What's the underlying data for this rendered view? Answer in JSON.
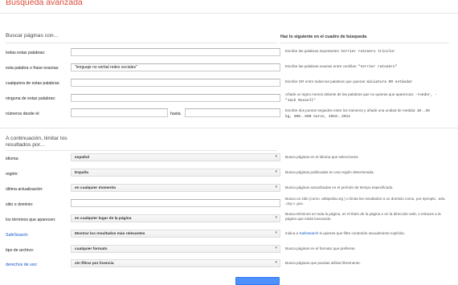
{
  "page_title": "Búsqueda avanzada",
  "find_section": {
    "heading": "Buscar páginas con...",
    "right_heading": "Haz lo siguiente en el cuadro de búsqueda",
    "rows": [
      {
        "label": "todas estas palabras:",
        "value": "",
        "desc_pre": "Escribe las palabras importantes: ",
        "desc_code": "terrier ratonero tricolor"
      },
      {
        "label": "esta palabra o frase exactas:",
        "value": "\"lenguaje no verbal redes sociales\"",
        "desc_pre": "Escribe las palabras exactas entre comillas: ",
        "desc_code": "\"terrier ratonero\""
      },
      {
        "label": "cualquiera de estas palabras:",
        "value": "",
        "desc_pre": "Escribe OR entre todas las palabras que quieras: ",
        "desc_code": "miniatura OR estándar"
      },
      {
        "label": "ninguna de estas palabras:",
        "value": "",
        "desc_pre": "Añade un signo menos delante de las palabras que no quieras que aparezcan: ",
        "desc_code": "-roedor, -\"Jack Russell\""
      }
    ],
    "numbers": {
      "label": "números desde el:",
      "from_value": "",
      "to_label": "hasta",
      "to_value": "",
      "desc_pre": "Escribe dos puntos seguidos entre los números y añade una unidad de medida: ",
      "desc_code": "10..35 kg, 300..500 euros, 2010..2011"
    }
  },
  "narrow_section": {
    "heading_line1": "A continuación, limitar los",
    "heading_line2": "resultados por...",
    "rows": [
      {
        "label": "idioma:",
        "value": "español",
        "desc": "Busca páginas en el idioma que selecciones."
      },
      {
        "label": "región:",
        "value": "España",
        "desc": "Busca páginas publicadas en una región determinada."
      },
      {
        "label": "última actualización:",
        "value": "en cualquier momento",
        "desc": "Busca páginas actualizadas en el período de tiempo especificado."
      },
      {
        "label": "sitio o dominio:",
        "value": "",
        "desc": "Busca un sitio (como  .wikipedia.org ) o limita los resultados a un dominio como, por ejemplo, .edu, .org o .gov."
      },
      {
        "label": "los términos que aparecen:",
        "value": "en cualquier lugar de la página",
        "desc": "Busca términos en toda la página, en el título de la página o en la dirección web, o enlaces a la página que estás buscando."
      },
      {
        "label": "SafeSearch:",
        "value": "Mostrar los resultados más relevantes",
        "desc_pre": "Indica a ",
        "desc_link": "SafeSearch",
        "desc_post": " si quieres que filtre contenido sexualmente explícito."
      },
      {
        "label": "tipo de archivo:",
        "value": "cualquier formato",
        "desc": "Busca páginas en el formato que prefieras."
      },
      {
        "label": "derechos de uso:",
        "value": "sin filtrar por licencia",
        "desc": "Busca páginas que puedas utilizar libremente."
      }
    ]
  },
  "colors": {
    "title": "#dd4b39",
    "link": "#1155cc",
    "button": "#4d90fe"
  }
}
